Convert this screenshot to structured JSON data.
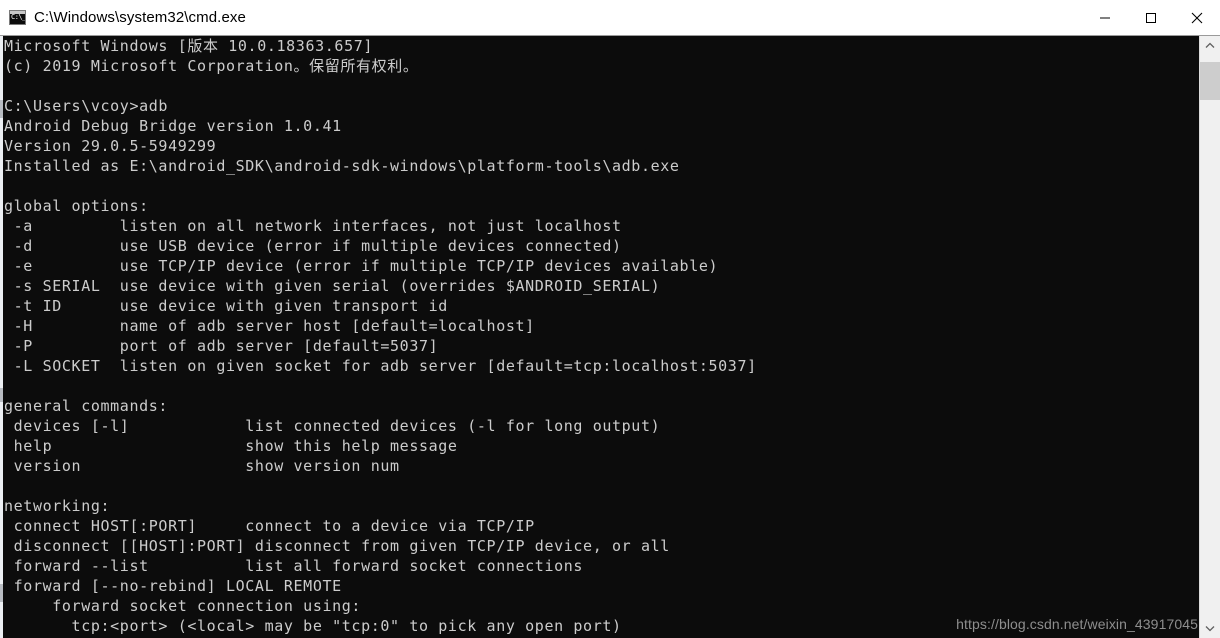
{
  "window": {
    "title": "C:\\Windows\\system32\\cmd.exe",
    "icon_label": "C:\\_",
    "icon_name": "cmd-icon",
    "minimize_label": "Minimize",
    "maximize_label": "Maximize",
    "close_label": "Close",
    "titlebar_bg": "#ffffff",
    "titlebar_fg": "#000000"
  },
  "terminal": {
    "background": "#0c0c0c",
    "foreground": "#cccccc",
    "font_size_px": 15,
    "line_height_px": 20,
    "lines": [
      "Microsoft Windows [版本 10.0.18363.657]",
      "(c) 2019 Microsoft Corporation。保留所有权利。",
      "",
      "C:\\Users\\vcoy>adb",
      "Android Debug Bridge version 1.0.41",
      "Version 29.0.5-5949299",
      "Installed as E:\\android_SDK\\android-sdk-windows\\platform-tools\\adb.exe",
      "",
      "global options:",
      " -a         listen on all network interfaces, not just localhost",
      " -d         use USB device (error if multiple devices connected)",
      " -e         use TCP/IP device (error if multiple TCP/IP devices available)",
      " -s SERIAL  use device with given serial (overrides $ANDROID_SERIAL)",
      " -t ID      use device with given transport id",
      " -H         name of adb server host [default=localhost]",
      " -P         port of adb server [default=5037]",
      " -L SOCKET  listen on given socket for adb server [default=tcp:localhost:5037]",
      "",
      "general commands:",
      " devices [-l]            list connected devices (-l for long output)",
      " help                    show this help message",
      " version                 show version num",
      "",
      "networking:",
      " connect HOST[:PORT]     connect to a device via TCP/IP",
      " disconnect [[HOST]:PORT] disconnect from given TCP/IP device, or all",
      " forward --list          list all forward socket connections",
      " forward [--no-rebind] LOCAL REMOTE",
      "     forward socket connection using:",
      "       tcp:<port> (<local> may be \"tcp:0\" to pick any open port)"
    ]
  },
  "watermark": {
    "text": "https://blog.csdn.net/weixin_43917045"
  },
  "scrollbar": {
    "up_arrow_name": "scroll-up",
    "down_arrow_name": "scroll-down",
    "thumb_name": "scroll-thumb"
  }
}
